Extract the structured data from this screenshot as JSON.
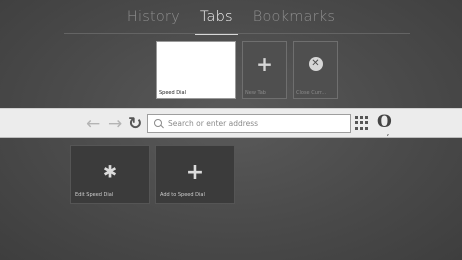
{
  "topnav": {
    "tabs": [
      {
        "label": "History",
        "active": false
      },
      {
        "label": "Tabs",
        "active": true
      },
      {
        "label": "Bookmarks",
        "active": false
      }
    ]
  },
  "open_tabs": {
    "current": {
      "label": "Speed Dial"
    },
    "new_tab": {
      "label": "New Tab",
      "icon": "plus-icon"
    },
    "close_current": {
      "label": "Close Curr...",
      "icon": "close-circle-icon"
    }
  },
  "address_bar": {
    "back_icon": "arrow-left-icon",
    "forward_icon": "arrow-right-icon",
    "reload_icon": "reload-icon",
    "search_placeholder": "Search or enter address",
    "search_value": "",
    "menu_icon": "grid-menu-icon",
    "logo_icon": "opera-logo-icon"
  },
  "speed_dial": {
    "tiles": [
      {
        "label": "Edit Speed Dial",
        "icon": "gear-icon"
      },
      {
        "label": "Add to Speed Dial",
        "icon": "plus-icon"
      }
    ]
  },
  "colors": {
    "background": "#4a4a4a",
    "address_bar": "#ececec",
    "tile": "#3b3b3b",
    "active_text": "#f2f2f2",
    "inactive_text": "#8e8e8e"
  }
}
